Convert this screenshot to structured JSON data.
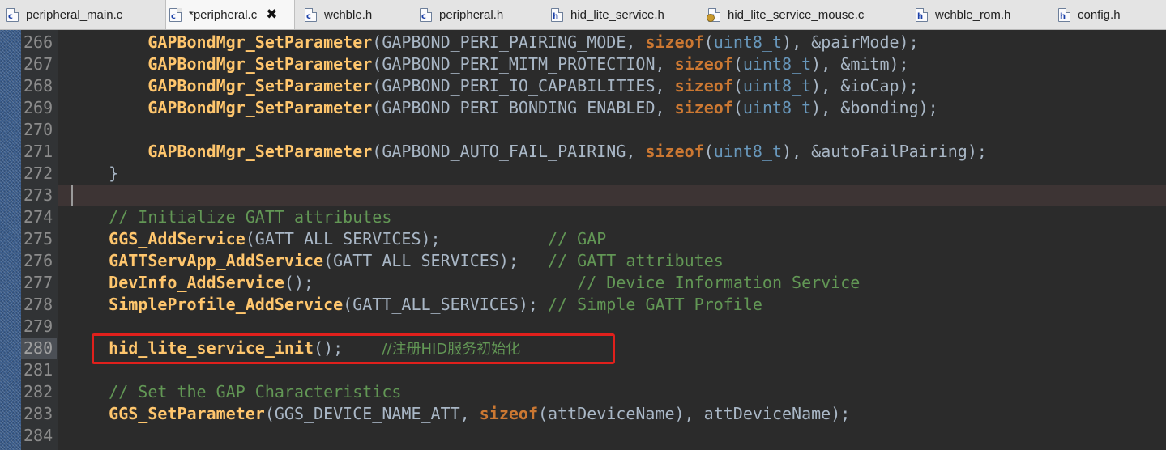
{
  "tabs": [
    {
      "label": "peripheral_main.c",
      "icon": "c-file-icon",
      "active": false
    },
    {
      "label": "*peripheral.c",
      "icon": "c-file-icon",
      "active": true
    },
    {
      "label": "wchble.h",
      "icon": "c-file-icon",
      "active": false
    },
    {
      "label": "peripheral.h",
      "icon": "c-file-icon",
      "active": false
    },
    {
      "label": "hid_lite_service.h",
      "icon": "h-file-icon",
      "active": false
    },
    {
      "label": "hid_lite_service_mouse.c",
      "icon": "c-file-modified-icon",
      "active": false
    },
    {
      "label": "wchble_rom.h",
      "icon": "h-file-icon",
      "active": false
    },
    {
      "label": "config.h",
      "icon": "h-file-icon",
      "active": false
    }
  ],
  "colors": {
    "background": "#2b2b2b",
    "function": "#ffc66d",
    "keyword": "#cc7832",
    "type": "#6897bb",
    "comment": "#629755",
    "plain": "#a9b7c6",
    "highlight_box": "#e0201c"
  },
  "code_lines": [
    {
      "num": "266",
      "segments": [
        [
          "    ",
          ""
        ],
        [
          "GAPBondMgr_SetParameter",
          "fn"
        ],
        [
          "(GAPBOND_PERI_PAIRING_MODE, ",
          ""
        ],
        [
          "sizeof",
          "kw"
        ],
        [
          "(",
          ""
        ],
        [
          "uint8_t",
          "ty"
        ],
        [
          "), &pairMode);",
          ""
        ]
      ]
    },
    {
      "num": "267",
      "segments": [
        [
          "    ",
          ""
        ],
        [
          "GAPBondMgr_SetParameter",
          "fn"
        ],
        [
          "(GAPBOND_PERI_MITM_PROTECTION, ",
          ""
        ],
        [
          "sizeof",
          "kw"
        ],
        [
          "(",
          ""
        ],
        [
          "uint8_t",
          "ty"
        ],
        [
          "), &mitm);",
          ""
        ]
      ]
    },
    {
      "num": "268",
      "segments": [
        [
          "    ",
          ""
        ],
        [
          "GAPBondMgr_SetParameter",
          "fn"
        ],
        [
          "(GAPBOND_PERI_IO_CAPABILITIES, ",
          ""
        ],
        [
          "sizeof",
          "kw"
        ],
        [
          "(",
          ""
        ],
        [
          "uint8_t",
          "ty"
        ],
        [
          "), &ioCap);",
          ""
        ]
      ]
    },
    {
      "num": "269",
      "segments": [
        [
          "    ",
          ""
        ],
        [
          "GAPBondMgr_SetParameter",
          "fn"
        ],
        [
          "(GAPBOND_PERI_BONDING_ENABLED, ",
          ""
        ],
        [
          "sizeof",
          "kw"
        ],
        [
          "(",
          ""
        ],
        [
          "uint8_t",
          "ty"
        ],
        [
          "), &bonding);",
          ""
        ]
      ]
    },
    {
      "num": "270",
      "segments": []
    },
    {
      "num": "271",
      "segments": [
        [
          "    ",
          ""
        ],
        [
          "GAPBondMgr_SetParameter",
          "fn"
        ],
        [
          "(GAPBOND_AUTO_FAIL_PAIRING, ",
          ""
        ],
        [
          "sizeof",
          "kw"
        ],
        [
          "(",
          ""
        ],
        [
          "uint8_t",
          "ty"
        ],
        [
          "), &autoFailPairing);",
          ""
        ]
      ]
    },
    {
      "num": "272",
      "segments": [
        [
          "}",
          ""
        ]
      ]
    },
    {
      "num": "273",
      "segments": [],
      "current": true
    },
    {
      "num": "274",
      "segments": [
        [
          "// Initialize GATT attributes",
          "cm"
        ]
      ]
    },
    {
      "num": "275",
      "segments": [
        [
          "GGS_AddService",
          "fn"
        ],
        [
          "(GATT_ALL_SERVICES);           ",
          ""
        ],
        [
          "// GAP",
          "cm"
        ]
      ]
    },
    {
      "num": "276",
      "segments": [
        [
          "GATTServApp_AddService",
          "fn"
        ],
        [
          "(GATT_ALL_SERVICES);   ",
          ""
        ],
        [
          "// GATT attributes",
          "cm"
        ]
      ]
    },
    {
      "num": "277",
      "segments": [
        [
          "DevInfo_AddService",
          "fn"
        ],
        [
          "();                           ",
          ""
        ],
        [
          "// Device Information Service",
          "cm"
        ]
      ]
    },
    {
      "num": "278",
      "segments": [
        [
          "SimpleProfile_AddService",
          "fn"
        ],
        [
          "(GATT_ALL_SERVICES); ",
          ""
        ],
        [
          "// Simple GATT Profile",
          "cm"
        ]
      ]
    },
    {
      "num": "279",
      "segments": []
    },
    {
      "num": "280",
      "segments": [
        [
          "hid_lite_service_init",
          "fn"
        ],
        [
          "();    ",
          ""
        ],
        [
          "//注册HID服务初始化",
          "cmcn"
        ]
      ],
      "selected_num": true
    },
    {
      "num": "281",
      "segments": []
    },
    {
      "num": "282",
      "segments": [
        [
          "// Set the GAP Characteristics",
          "cm"
        ]
      ]
    },
    {
      "num": "283",
      "segments": [
        [
          "GGS_SetParameter",
          "fn"
        ],
        [
          "(GGS_DEVICE_NAME_ATT, ",
          ""
        ],
        [
          "sizeof",
          "kw"
        ],
        [
          "(attDeviceName), attDeviceName);",
          ""
        ]
      ]
    },
    {
      "num": "284",
      "segments": []
    }
  ]
}
